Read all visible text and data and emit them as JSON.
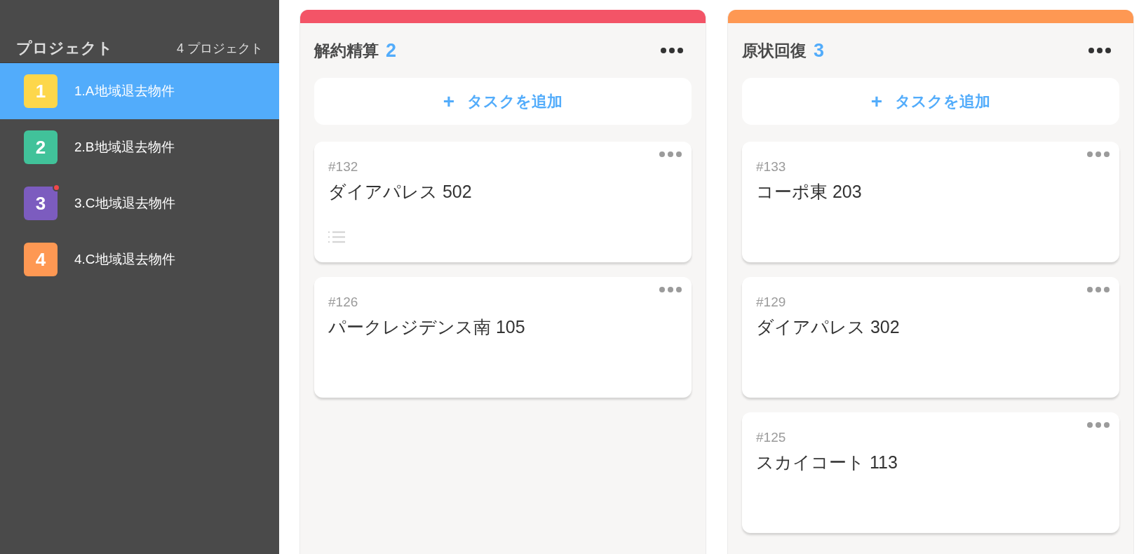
{
  "sidebar": {
    "title": "プロジェクト",
    "count": "4 プロジェクト",
    "items": [
      {
        "number": "1",
        "label": "1.A地域退去物件",
        "color": "#fdd74b",
        "selected": true,
        "notification": false
      },
      {
        "number": "2",
        "label": "2.B地域退去物件",
        "color": "#41c29a",
        "selected": false,
        "notification": false
      },
      {
        "number": "3",
        "label": "3.C地域退去物件",
        "color": "#7c5cbf",
        "selected": false,
        "notification": true
      },
      {
        "number": "4",
        "label": "4.C地域退去物件",
        "color": "#fe9853",
        "selected": false,
        "notification": false
      }
    ]
  },
  "columns": [
    {
      "title": "解約精算",
      "count": "2",
      "color": "#f35467",
      "add_label": "タスクを追加",
      "add_icon": "+",
      "cards": [
        {
          "id": "#132",
          "title": "ダイアパレス 502",
          "has_description": true
        },
        {
          "id": "#126",
          "title": "パークレジデンス南 105",
          "has_description": false
        }
      ]
    },
    {
      "title": "原状回復",
      "count": "3",
      "color": "#fe9853",
      "add_label": "タスクを追加",
      "add_icon": "+",
      "cards": [
        {
          "id": "#133",
          "title": "コーポ東 203",
          "has_description": false
        },
        {
          "id": "#129",
          "title": "ダイアパレス 302",
          "has_description": false
        },
        {
          "id": "#125",
          "title": "スカイコート 113",
          "has_description": false
        }
      ]
    }
  ]
}
